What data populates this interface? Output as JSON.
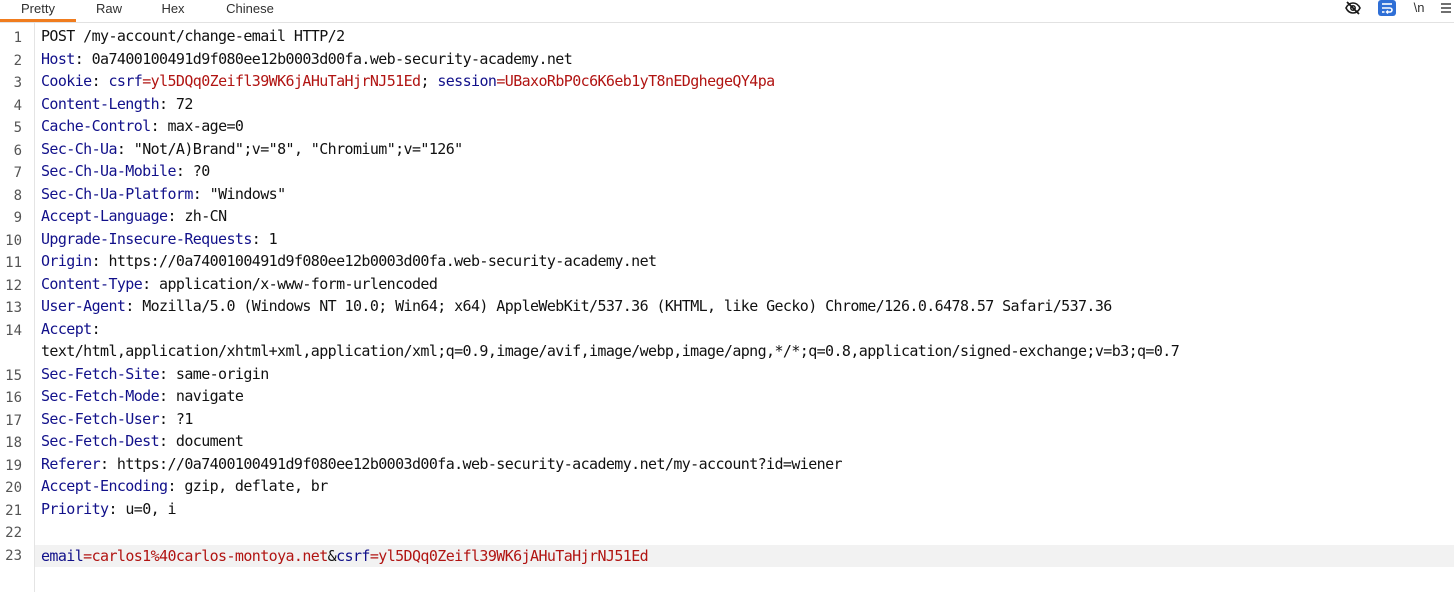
{
  "tabs": [
    {
      "label": "Pretty",
      "active": true
    },
    {
      "label": "Raw",
      "active": false
    },
    {
      "label": "Hex",
      "active": false
    },
    {
      "label": "Chinese",
      "active": false
    }
  ],
  "toolbar": {
    "hide_icon": "eye-slash-icon",
    "wrap_icon": "word-wrap-icon",
    "newline_label": "\\n",
    "menu_icon": "menu-icon"
  },
  "colors": {
    "header_key": "#11108a",
    "value_red": "#b11412",
    "active_tab_underline": "#f07c1e"
  },
  "request": {
    "request_line": "POST /my-account/change-email HTTP/2",
    "headers": [
      {
        "name": "Host",
        "value": "0a7400100491d9f080ee12b0003d00fa.web-security-academy.net"
      },
      {
        "name": "Content-Length",
        "value": "72"
      },
      {
        "name": "Cache-Control",
        "value": "max-age=0"
      },
      {
        "name": "Sec-Ch-Ua",
        "value": "\"Not/A)Brand\";v=\"8\", \"Chromium\";v=\"126\""
      },
      {
        "name": "Sec-Ch-Ua-Mobile",
        "value": "?0"
      },
      {
        "name": "Sec-Ch-Ua-Platform",
        "value": "\"Windows\""
      },
      {
        "name": "Accept-Language",
        "value": "zh-CN"
      },
      {
        "name": "Upgrade-Insecure-Requests",
        "value": "1"
      },
      {
        "name": "Origin",
        "value": "https://0a7400100491d9f080ee12b0003d00fa.web-security-academy.net"
      },
      {
        "name": "Content-Type",
        "value": "application/x-www-form-urlencoded"
      },
      {
        "name": "User-Agent",
        "value": "Mozilla/5.0 (Windows NT 10.0; Win64; x64) AppleWebKit/537.36 (KHTML, like Gecko) Chrome/126.0.6478.57 Safari/537.36"
      },
      {
        "name": "Accept",
        "value": "text/html,application/xhtml+xml,application/xml;q=0.9,image/avif,image/webp,image/apng,*/*;q=0.8,application/signed-exchange;v=b3;q=0.7"
      },
      {
        "name": "Sec-Fetch-Site",
        "value": "same-origin"
      },
      {
        "name": "Sec-Fetch-Mode",
        "value": "navigate"
      },
      {
        "name": "Sec-Fetch-User",
        "value": "?1"
      },
      {
        "name": "Sec-Fetch-Dest",
        "value": "document"
      },
      {
        "name": "Referer",
        "value": "https://0a7400100491d9f080ee12b0003d00fa.web-security-academy.net/my-account?id=wiener"
      },
      {
        "name": "Accept-Encoding",
        "value": "gzip, deflate, br"
      },
      {
        "name": "Priority",
        "value": "u=0, i"
      }
    ],
    "cookie": {
      "header": "Cookie",
      "csrf_name": "csrf",
      "csrf_value": "yl5DQq0Zeifl39WK6jAHuTaHjrNJ51Ed",
      "session_name": "session",
      "session_value": "UBaxoRbP0c6K6eb1yT8nEDghegeQY4pa"
    },
    "body": {
      "email_name": "email",
      "email_value": "carlos1%40carlos-montoya.net",
      "csrf_name": "csrf",
      "csrf_value": "yl5DQq0Zeifl39WK6jAHuTaHjrNJ51Ed"
    },
    "line_numbers": [
      "1",
      "2",
      "3",
      "4",
      "5",
      "6",
      "7",
      "8",
      "9",
      "10",
      "11",
      "12",
      "13",
      "14",
      "15",
      "16",
      "17",
      "18",
      "19",
      "20",
      "21",
      "22",
      "23"
    ]
  }
}
